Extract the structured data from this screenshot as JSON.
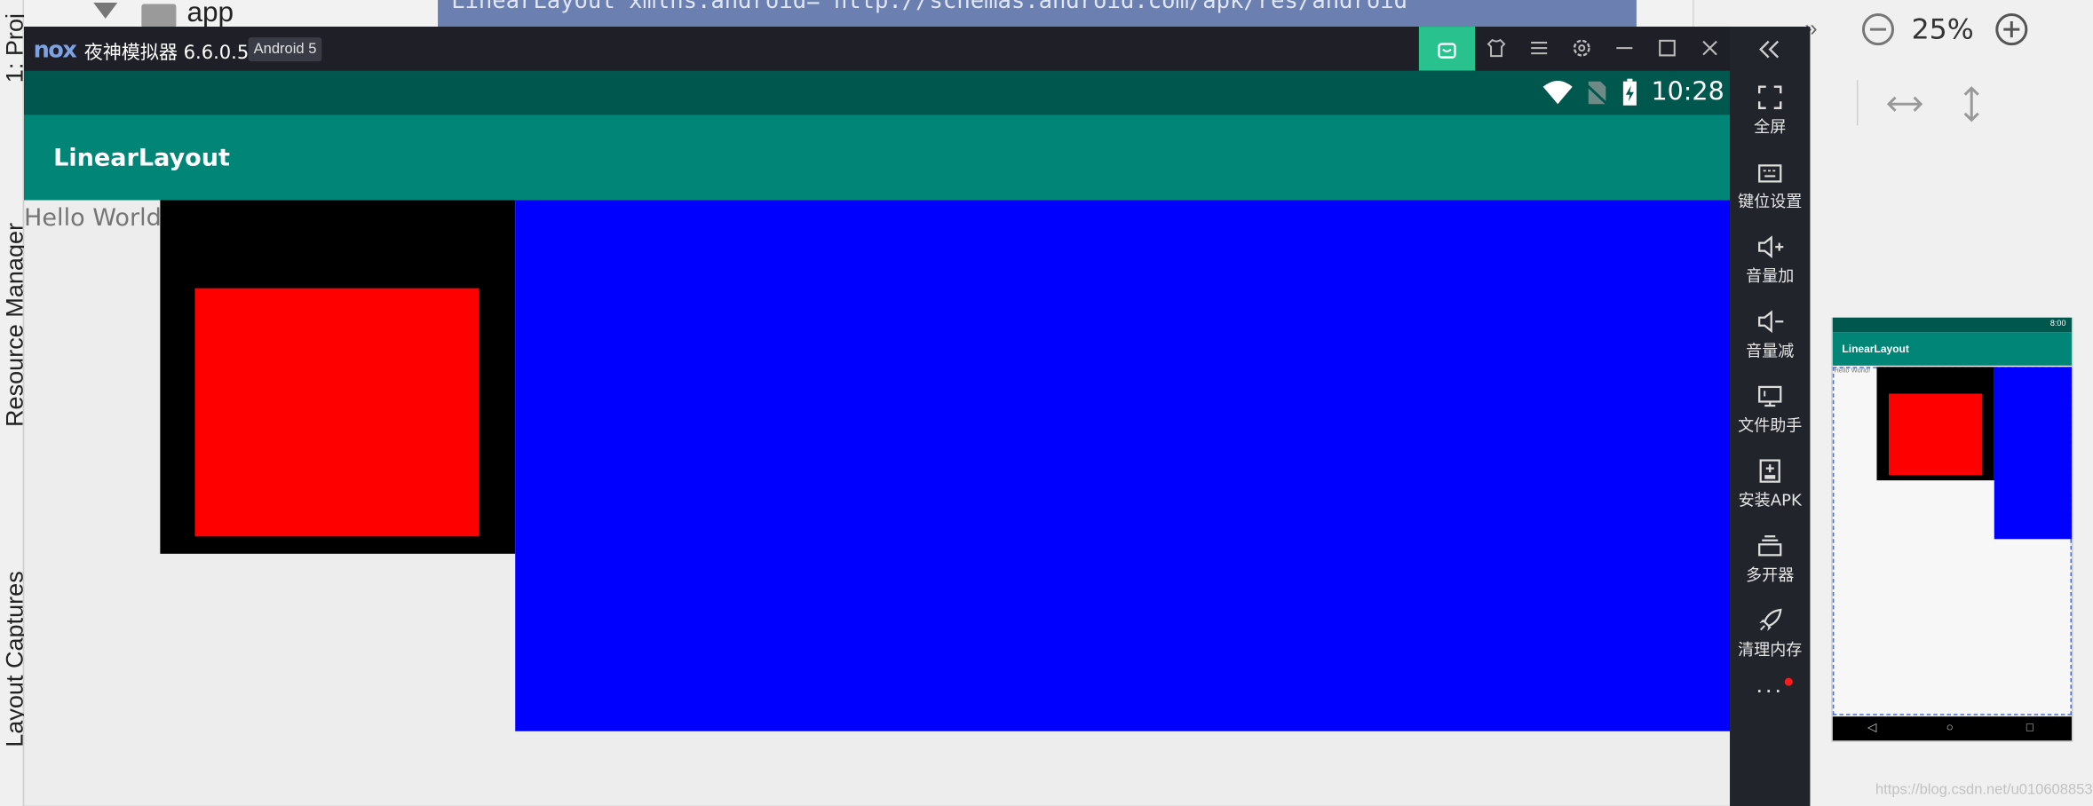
{
  "ide": {
    "left_tabs": [
      "1: Proj",
      "Resource Manager",
      "Layout Captures"
    ],
    "project_label": "app",
    "code_line": "LinearLayout xmlns:android=\"http://schemas.android.com/apk/res/android\"",
    "zoom_level": "25%"
  },
  "emulator": {
    "logo": "nox",
    "title": "夜神模拟器 6.6.0.5",
    "android_badge": "Android 5",
    "status_time": "10:28",
    "sidebar": [
      {
        "label": "全屏",
        "icon": "fullscreen-icon"
      },
      {
        "label": "键位设置",
        "icon": "keyboard-icon"
      },
      {
        "label": "音量加",
        "icon": "volume-up-icon"
      },
      {
        "label": "音量减",
        "icon": "volume-down-icon"
      },
      {
        "label": "文件助手",
        "icon": "file-assistant-icon"
      },
      {
        "label": "安装APK",
        "icon": "install-apk-icon"
      },
      {
        "label": "多开器",
        "icon": "multi-instance-icon"
      },
      {
        "label": "清理内存",
        "icon": "rocket-icon"
      }
    ],
    "more": "···"
  },
  "app": {
    "title": "LinearLayout",
    "hello": "Hello World!",
    "colors": {
      "status_bar": "#00574d",
      "app_bar": "#008577",
      "black_box": "#000000",
      "red_box": "#ff0000",
      "blue_box": "#0000ff"
    }
  },
  "preview": {
    "time": "8:00",
    "title": "LinearLayout",
    "hello": "Hello World!",
    "nav": [
      "◁",
      "○",
      "□"
    ]
  },
  "watermark": "https://blog.csdn.net/u010608853"
}
